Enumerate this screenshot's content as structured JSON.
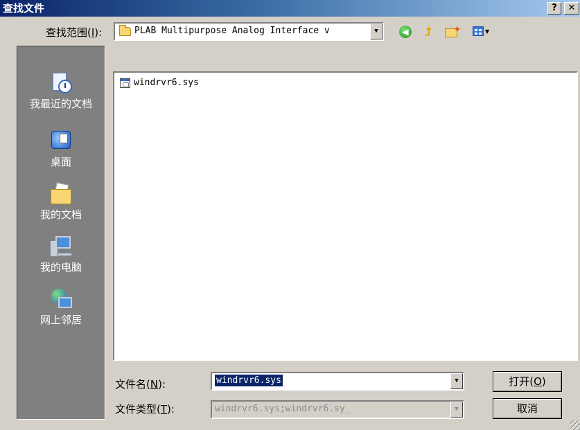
{
  "dialog": {
    "title": "查找文件",
    "help_label": "?",
    "close_label": "✕"
  },
  "lookin": {
    "label": "查找范围(",
    "hotkey": "I",
    "label_suffix": "):",
    "value": "PLAB Multipurpose Analog Interface v"
  },
  "toolbar": {
    "back_icon": "back-icon",
    "up_icon": "up-folder-icon",
    "new_folder_icon": "new-folder-icon",
    "views_icon": "views-menu-icon"
  },
  "places": [
    {
      "label": "我最近的文档",
      "icon": "recent-documents-icon"
    },
    {
      "label": "桌面",
      "icon": "desktop-icon"
    },
    {
      "label": "我的文档",
      "icon": "my-documents-icon"
    },
    {
      "label": "我的电脑",
      "icon": "my-computer-icon"
    },
    {
      "label": "网上邻居",
      "icon": "network-places-icon"
    }
  ],
  "files": [
    {
      "name": "windrvr6.sys",
      "icon": "system-file-icon"
    }
  ],
  "filename": {
    "label": "文件名(",
    "hotkey": "N",
    "label_suffix": "):",
    "value": "windrvr6.sys"
  },
  "filetype": {
    "label": "文件类型(",
    "hotkey": "T",
    "label_suffix": "):",
    "value": "windrvr6.sys;windrvr6.sy_"
  },
  "buttons": {
    "open_label": "打开(",
    "open_hotkey": "O",
    "open_suffix": ")",
    "cancel_label": "取消"
  }
}
